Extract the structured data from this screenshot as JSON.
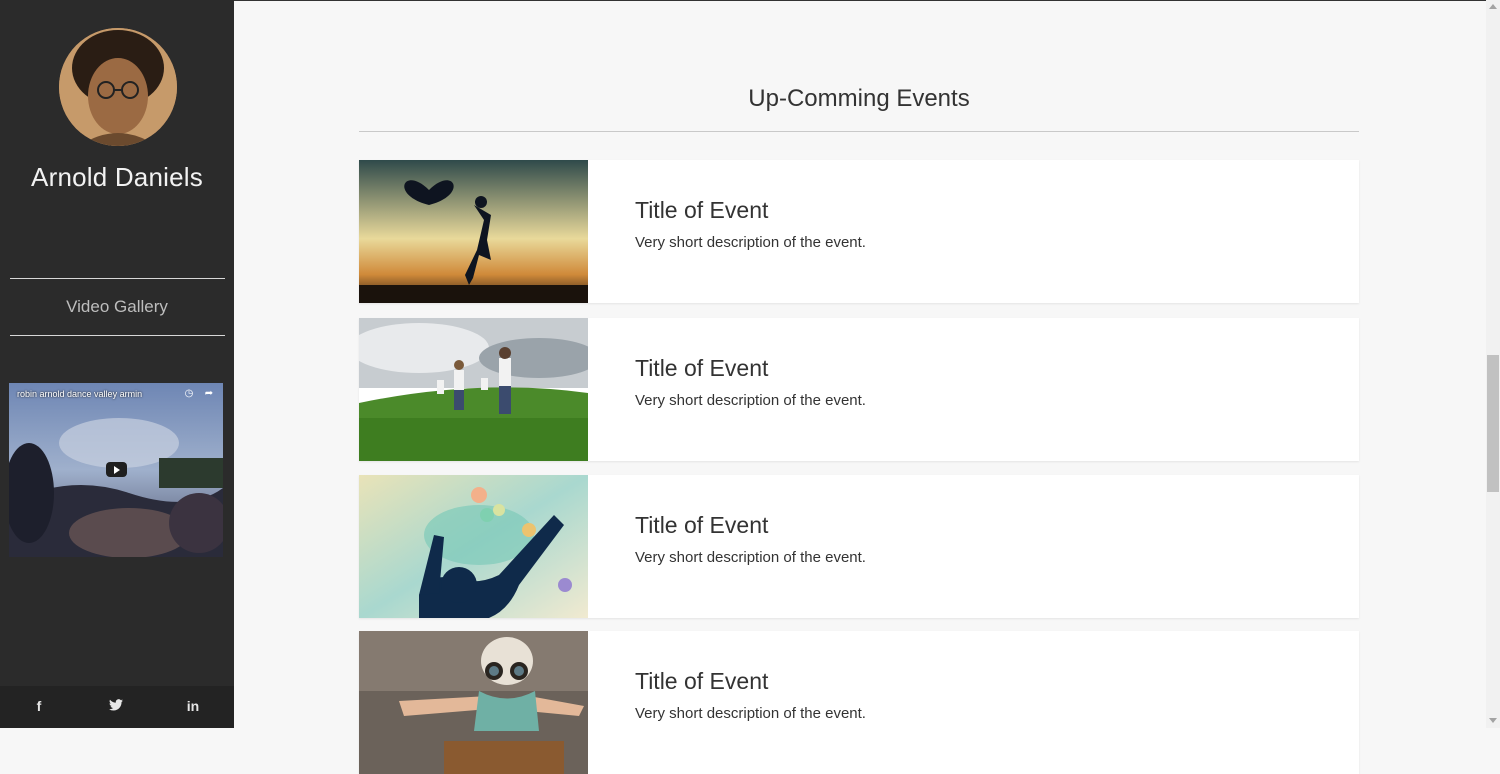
{
  "profile": {
    "name": "Arnold Daniels"
  },
  "sidebar": {
    "section_title": "Video Gallery"
  },
  "video": {
    "title": "robin arnold dance valley armin"
  },
  "social": [
    {
      "icon": "facebook-icon",
      "glyph": "f"
    },
    {
      "icon": "twitter-icon",
      "glyph": "🐦"
    },
    {
      "icon": "linkedin-icon",
      "glyph": "in"
    }
  ],
  "main": {
    "title": "Up-Comming Events"
  },
  "events": [
    {
      "title": "Title of Event",
      "description": "Very short description of the event.",
      "image": "silhouette-heart-sunset"
    },
    {
      "title": "Title of Event",
      "description": "Very short description of the event.",
      "image": "family-running-meadow"
    },
    {
      "title": "Title of Event",
      "description": "Very short description of the event.",
      "image": "balloons-smoke-silhouette"
    },
    {
      "title": "Title of Event",
      "description": "Very short description of the event.",
      "image": "child-aviator-goggles"
    }
  ],
  "colors": {
    "sidebar_bg": "#2b2b2b",
    "page_bg": "#f7f7f7",
    "card_bg": "#ffffff"
  }
}
